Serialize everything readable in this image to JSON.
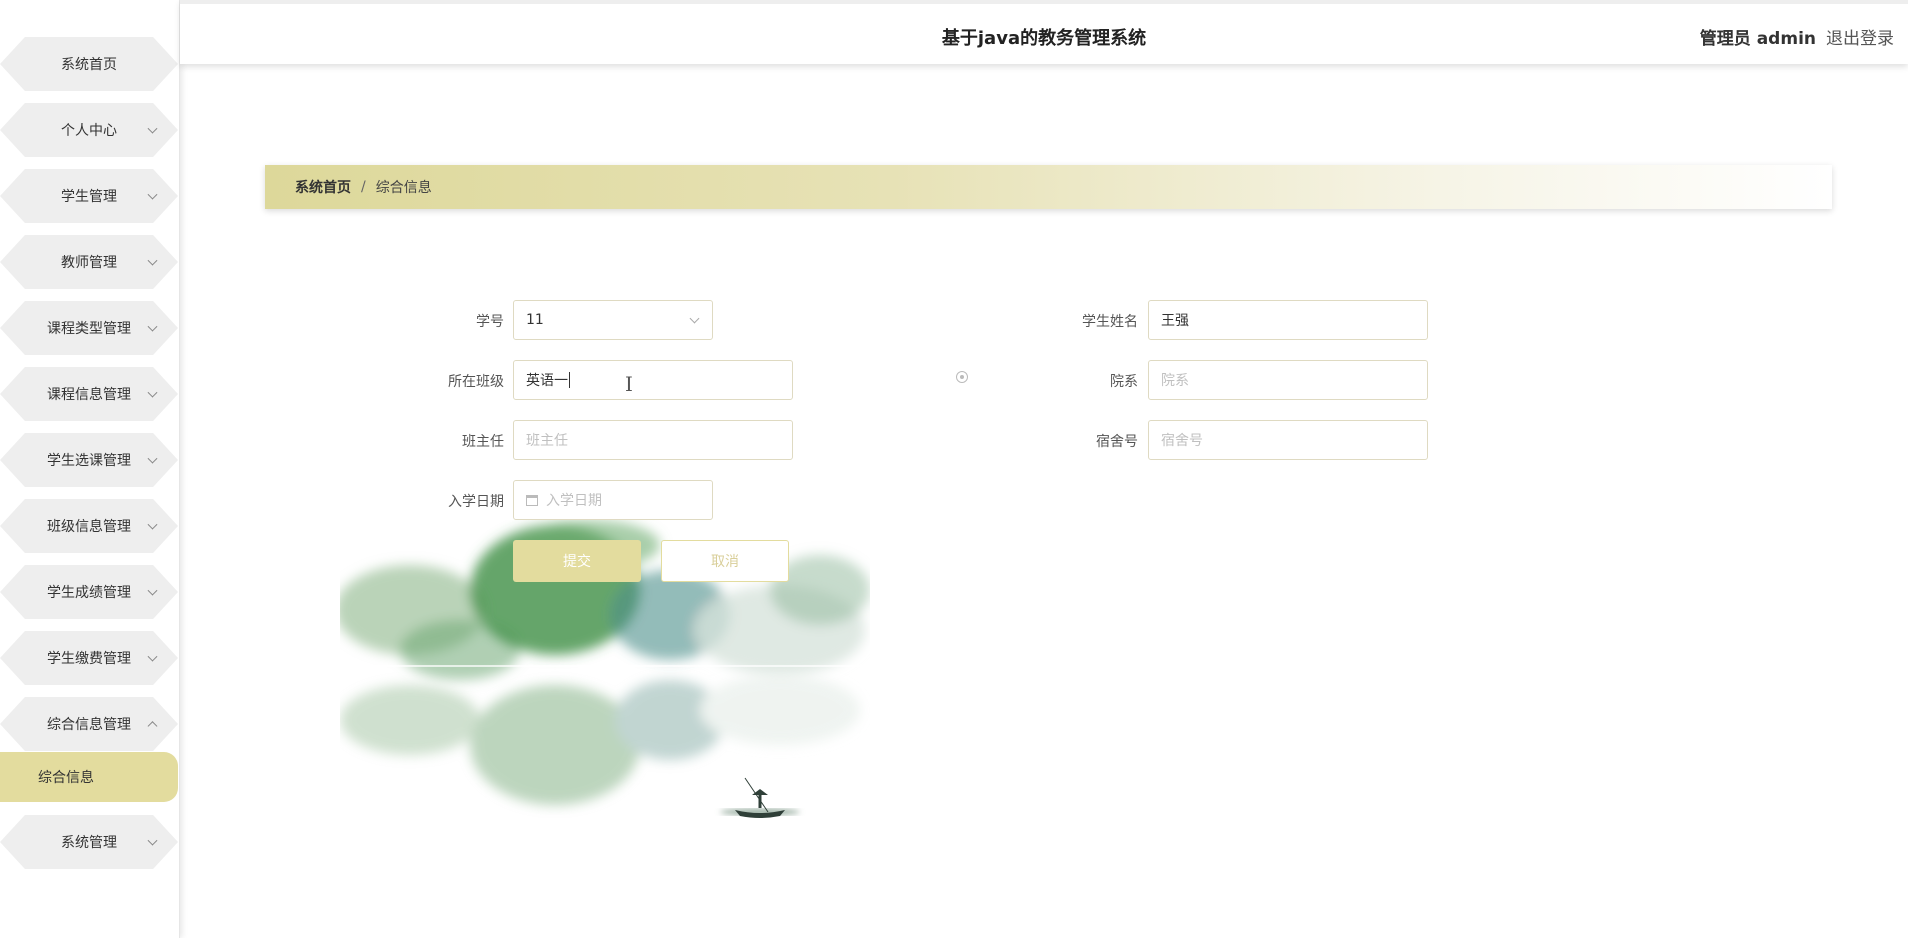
{
  "header": {
    "title": "基于java的教务管理系统",
    "role": "管理员 admin",
    "logout": "退出登录"
  },
  "sidebar": {
    "items": [
      {
        "label": "系统首页",
        "has_arrow": false
      },
      {
        "label": "个人中心",
        "has_arrow": true
      },
      {
        "label": "学生管理",
        "has_arrow": true
      },
      {
        "label": "教师管理",
        "has_arrow": true
      },
      {
        "label": "课程类型管理",
        "has_arrow": true
      },
      {
        "label": "课程信息管理",
        "has_arrow": true
      },
      {
        "label": "学生选课管理",
        "has_arrow": true
      },
      {
        "label": "班级信息管理",
        "has_arrow": true
      },
      {
        "label": "学生成绩管理",
        "has_arrow": true
      },
      {
        "label": "学生缴费管理",
        "has_arrow": true
      },
      {
        "label": "综合信息管理",
        "has_arrow": true,
        "expanded": true
      },
      {
        "label": "系统管理",
        "has_arrow": true
      }
    ],
    "active_subitem": "综合信息"
  },
  "breadcrumb": {
    "home": "系统首页",
    "separator": "/",
    "current": "综合信息"
  },
  "form": {
    "student_id": {
      "label": "学号",
      "value": "11"
    },
    "student_name": {
      "label": "学生姓名",
      "value": "王强"
    },
    "class": {
      "label": "所在班级",
      "value": "英语一"
    },
    "department": {
      "label": "院系",
      "placeholder": "院系"
    },
    "head_teacher": {
      "label": "班主任",
      "placeholder": "班主任"
    },
    "dorm": {
      "label": "宿舍号",
      "placeholder": "宿舍号"
    },
    "enroll_date": {
      "label": "入学日期",
      "placeholder": "入学日期"
    },
    "submit": "提交",
    "cancel": "取消"
  },
  "colors": {
    "accent": "#e3dc9e",
    "sidebar_item_bg": "#eeeeee",
    "placeholder": "#c0c0c0"
  }
}
